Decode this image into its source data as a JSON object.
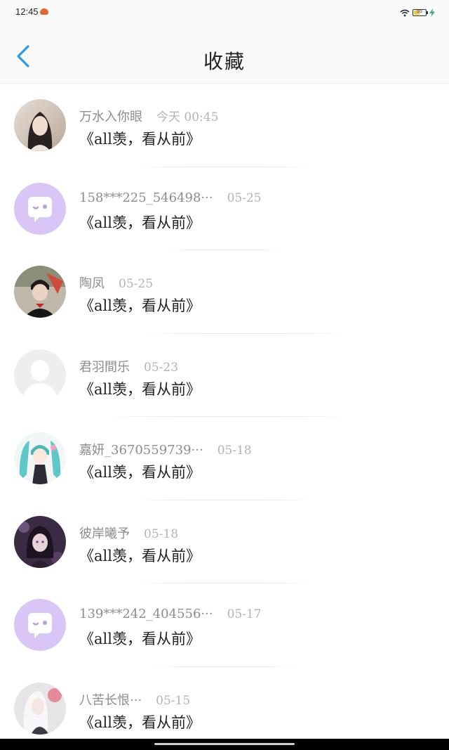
{
  "status_bar": {
    "time": "12:45",
    "battery_text": "55",
    "battery_level": 0.55,
    "icons": [
      "app-notification-icon",
      "wifi-icon",
      "battery-icon",
      "charging-icon"
    ]
  },
  "header": {
    "back_icon": "chevron-left-icon",
    "title": "收藏"
  },
  "colors": {
    "accent": "#2b9be8",
    "avatar_placeholder_purple": "#d9c6f6",
    "avatar_placeholder_gray": "#eeeeee",
    "username": "#8c8c8c",
    "time": "#b3b3b3",
    "title_text": "#222222"
  },
  "favorites": [
    {
      "username": "万水入你眼",
      "time": "今天 00:45",
      "book": "《all羡，看从前》",
      "avatar": "photo-girl-avatar"
    },
    {
      "username": "158***225_546498···",
      "time": "05-25",
      "book": "《all羡，看从前》",
      "avatar": "default-chat-avatar"
    },
    {
      "username": "陶凤",
      "time": "05-25",
      "book": "《all羡，看从前》",
      "avatar": "photo-boy-avatar"
    },
    {
      "username": "君羽間乐",
      "time": "05-23",
      "book": "《all羡，看从前》",
      "avatar": "default-person-avatar"
    },
    {
      "username": "嘉妍_3670559739···",
      "time": "05-18",
      "book": "《all羡，看从前》",
      "avatar": "anime-teal-avatar"
    },
    {
      "username": "彼岸曦予",
      "time": "05-18",
      "book": "《all羡，看从前》",
      "avatar": "anime-dark-avatar"
    },
    {
      "username": "139***242_404556···",
      "time": "05-17",
      "book": "《all羡，看从前》",
      "avatar": "default-chat-avatar"
    },
    {
      "username": "八苦长恨···",
      "time": "05-15",
      "book": "《all羡，看从前》",
      "avatar": "anime-white-hair-avatar"
    }
  ]
}
